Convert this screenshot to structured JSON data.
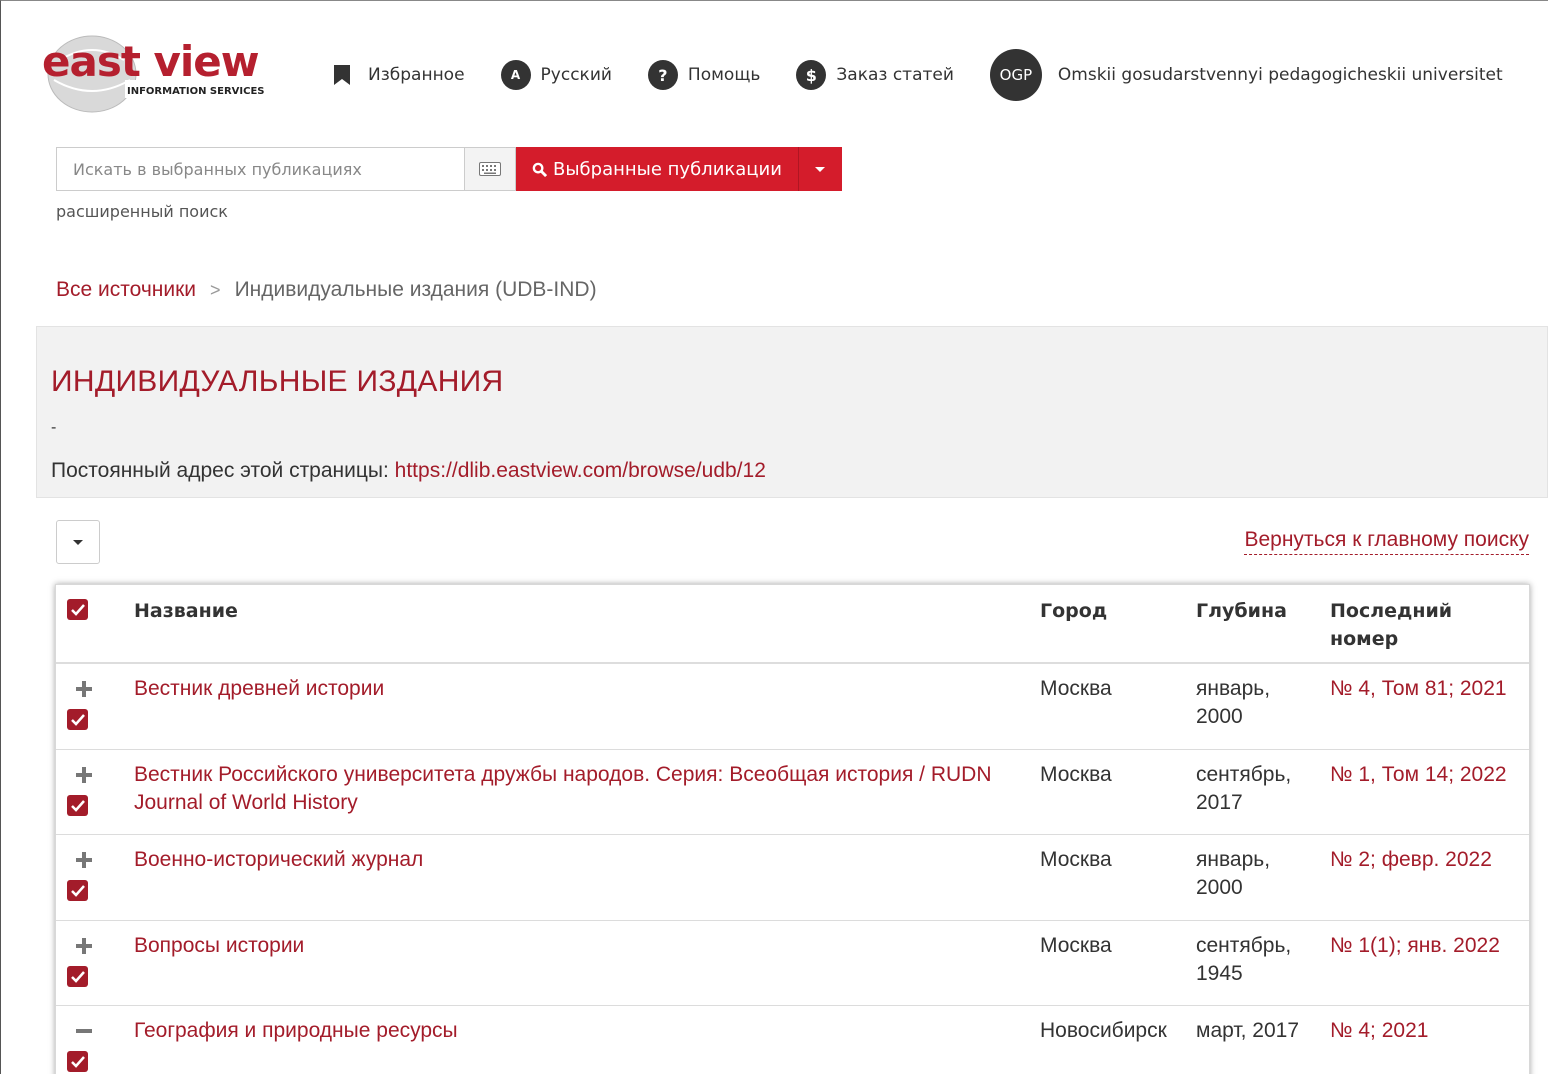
{
  "header": {
    "logo_main": "east view",
    "logo_sub": "INFORMATION SERVICES",
    "nav": {
      "favorites": "Избранное",
      "language": "Русский",
      "help": "Помощь",
      "order": "Заказ статей",
      "avatar": "OGP",
      "org": "Omskii gosudarstvennyi pedagogicheskii universitet"
    }
  },
  "search": {
    "placeholder": "Искать в выбранных публикациях",
    "button_label": "Выбранные публикации",
    "advanced": "расширенный поиск"
  },
  "breadcrumb": {
    "root": "Все источники",
    "current": "Индивидуальные издания (UDB-IND)"
  },
  "panel": {
    "title": "ИНДИВИДУАЛЬНЫЕ ИЗДАНИЯ",
    "dash": "-",
    "permalink_label": "Постоянный адрес этой страницы:",
    "permalink_url": "https://dlib.eastview.com/browse/udb/12"
  },
  "back_link": "Вернуться к главному поиску",
  "table": {
    "headers": {
      "name": "Название",
      "city": "Город",
      "depth": "Глубина",
      "last_line1": "Последний",
      "last_line2": "номер"
    },
    "rows": [
      {
        "name": "Вестник древней истории",
        "city": "Москва",
        "depth1": "январь,",
        "depth2": "2000",
        "last": "№ 4, Том 81; 2021",
        "expander": "plus"
      },
      {
        "name": "Вестник Российского университета дружбы народов. Серия: Всеобщая история / RUDN Journal of World History",
        "city": "Москва",
        "depth1": "сентябрь,",
        "depth2": "2017",
        "last": "№ 1, Том 14; 2022",
        "expander": "plus"
      },
      {
        "name": "Военно-исторический журнал",
        "city": "Москва",
        "depth1": "январь,",
        "depth2": "2000",
        "last": "№ 2; февр. 2022",
        "expander": "plus"
      },
      {
        "name": "Вопросы истории",
        "city": "Москва",
        "depth1": "сентябрь,",
        "depth2": "1945",
        "last": "№ 1(1); янв. 2022",
        "expander": "plus"
      },
      {
        "name": "География и природные ресурсы",
        "city": "Новосибирск",
        "depth1": "март, 2017",
        "depth2": "",
        "last": "№ 4; 2021",
        "expander": "minus"
      }
    ]
  },
  "colors": {
    "brand": "#a31c2a",
    "button": "#d41c2b",
    "panel_bg": "#f2f2f2"
  }
}
